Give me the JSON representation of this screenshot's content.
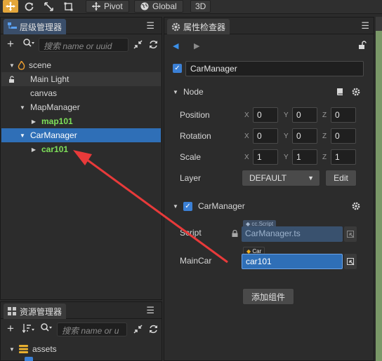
{
  "toolbar": {
    "buttons": [
      {
        "icon": "move-icon"
      },
      {
        "icon": "rotate-icon"
      },
      {
        "icon": "scale-icon"
      },
      {
        "icon": "rect-icon"
      }
    ],
    "pivot_label": "Pivot",
    "global_label": "Global",
    "mode3d_label": "3D"
  },
  "hierarchy": {
    "tab_label": "层级管理器",
    "search_placeholder": "搜索 name or uuid",
    "items": [
      {
        "label": "scene",
        "level": 0,
        "caret": "down",
        "icon": "scene-icon"
      },
      {
        "label": "Main Light",
        "level": 1,
        "caret": "none",
        "locked": true
      },
      {
        "label": "canvas",
        "level": 1,
        "caret": "none"
      },
      {
        "label": "MapManager",
        "level": 1,
        "caret": "down"
      },
      {
        "label": "map101",
        "level": 2,
        "caret": "right",
        "prefab": true
      },
      {
        "label": "CarManager",
        "level": 1,
        "caret": "down",
        "selected": true
      },
      {
        "label": "car101",
        "level": 2,
        "caret": "right",
        "prefab": true
      }
    ]
  },
  "assets": {
    "tab_label": "资源管理器",
    "search_placeholder": "搜索 name or u",
    "root": "assets"
  },
  "inspector": {
    "tab_label": "属性检查器",
    "node_name": "CarManager",
    "node_section": "Node",
    "position": {
      "label": "Position",
      "x": "0",
      "y": "0",
      "z": "0"
    },
    "rotation": {
      "label": "Rotation",
      "x": "0",
      "y": "0",
      "z": "0"
    },
    "scale": {
      "label": "Scale",
      "x": "1",
      "y": "1",
      "z": "1"
    },
    "layer": {
      "label": "Layer",
      "value": "DEFAULT",
      "edit_label": "Edit"
    },
    "axis_x": "X",
    "axis_y": "Y",
    "axis_z": "Z",
    "component": {
      "name": "CarManager",
      "script_label": "Script",
      "script_tag": "cc.Script",
      "script_value": "CarManager.ts",
      "maincar_label": "MainCar",
      "maincar_tag": "Car",
      "maincar_value": "car101"
    },
    "add_component_label": "添加组件"
  },
  "colors": {
    "accent": "#2f6fb7",
    "prefab_green": "#7ee05a",
    "arrow_red": "#e83a3a",
    "toolbar_active": "#e4a63a"
  }
}
